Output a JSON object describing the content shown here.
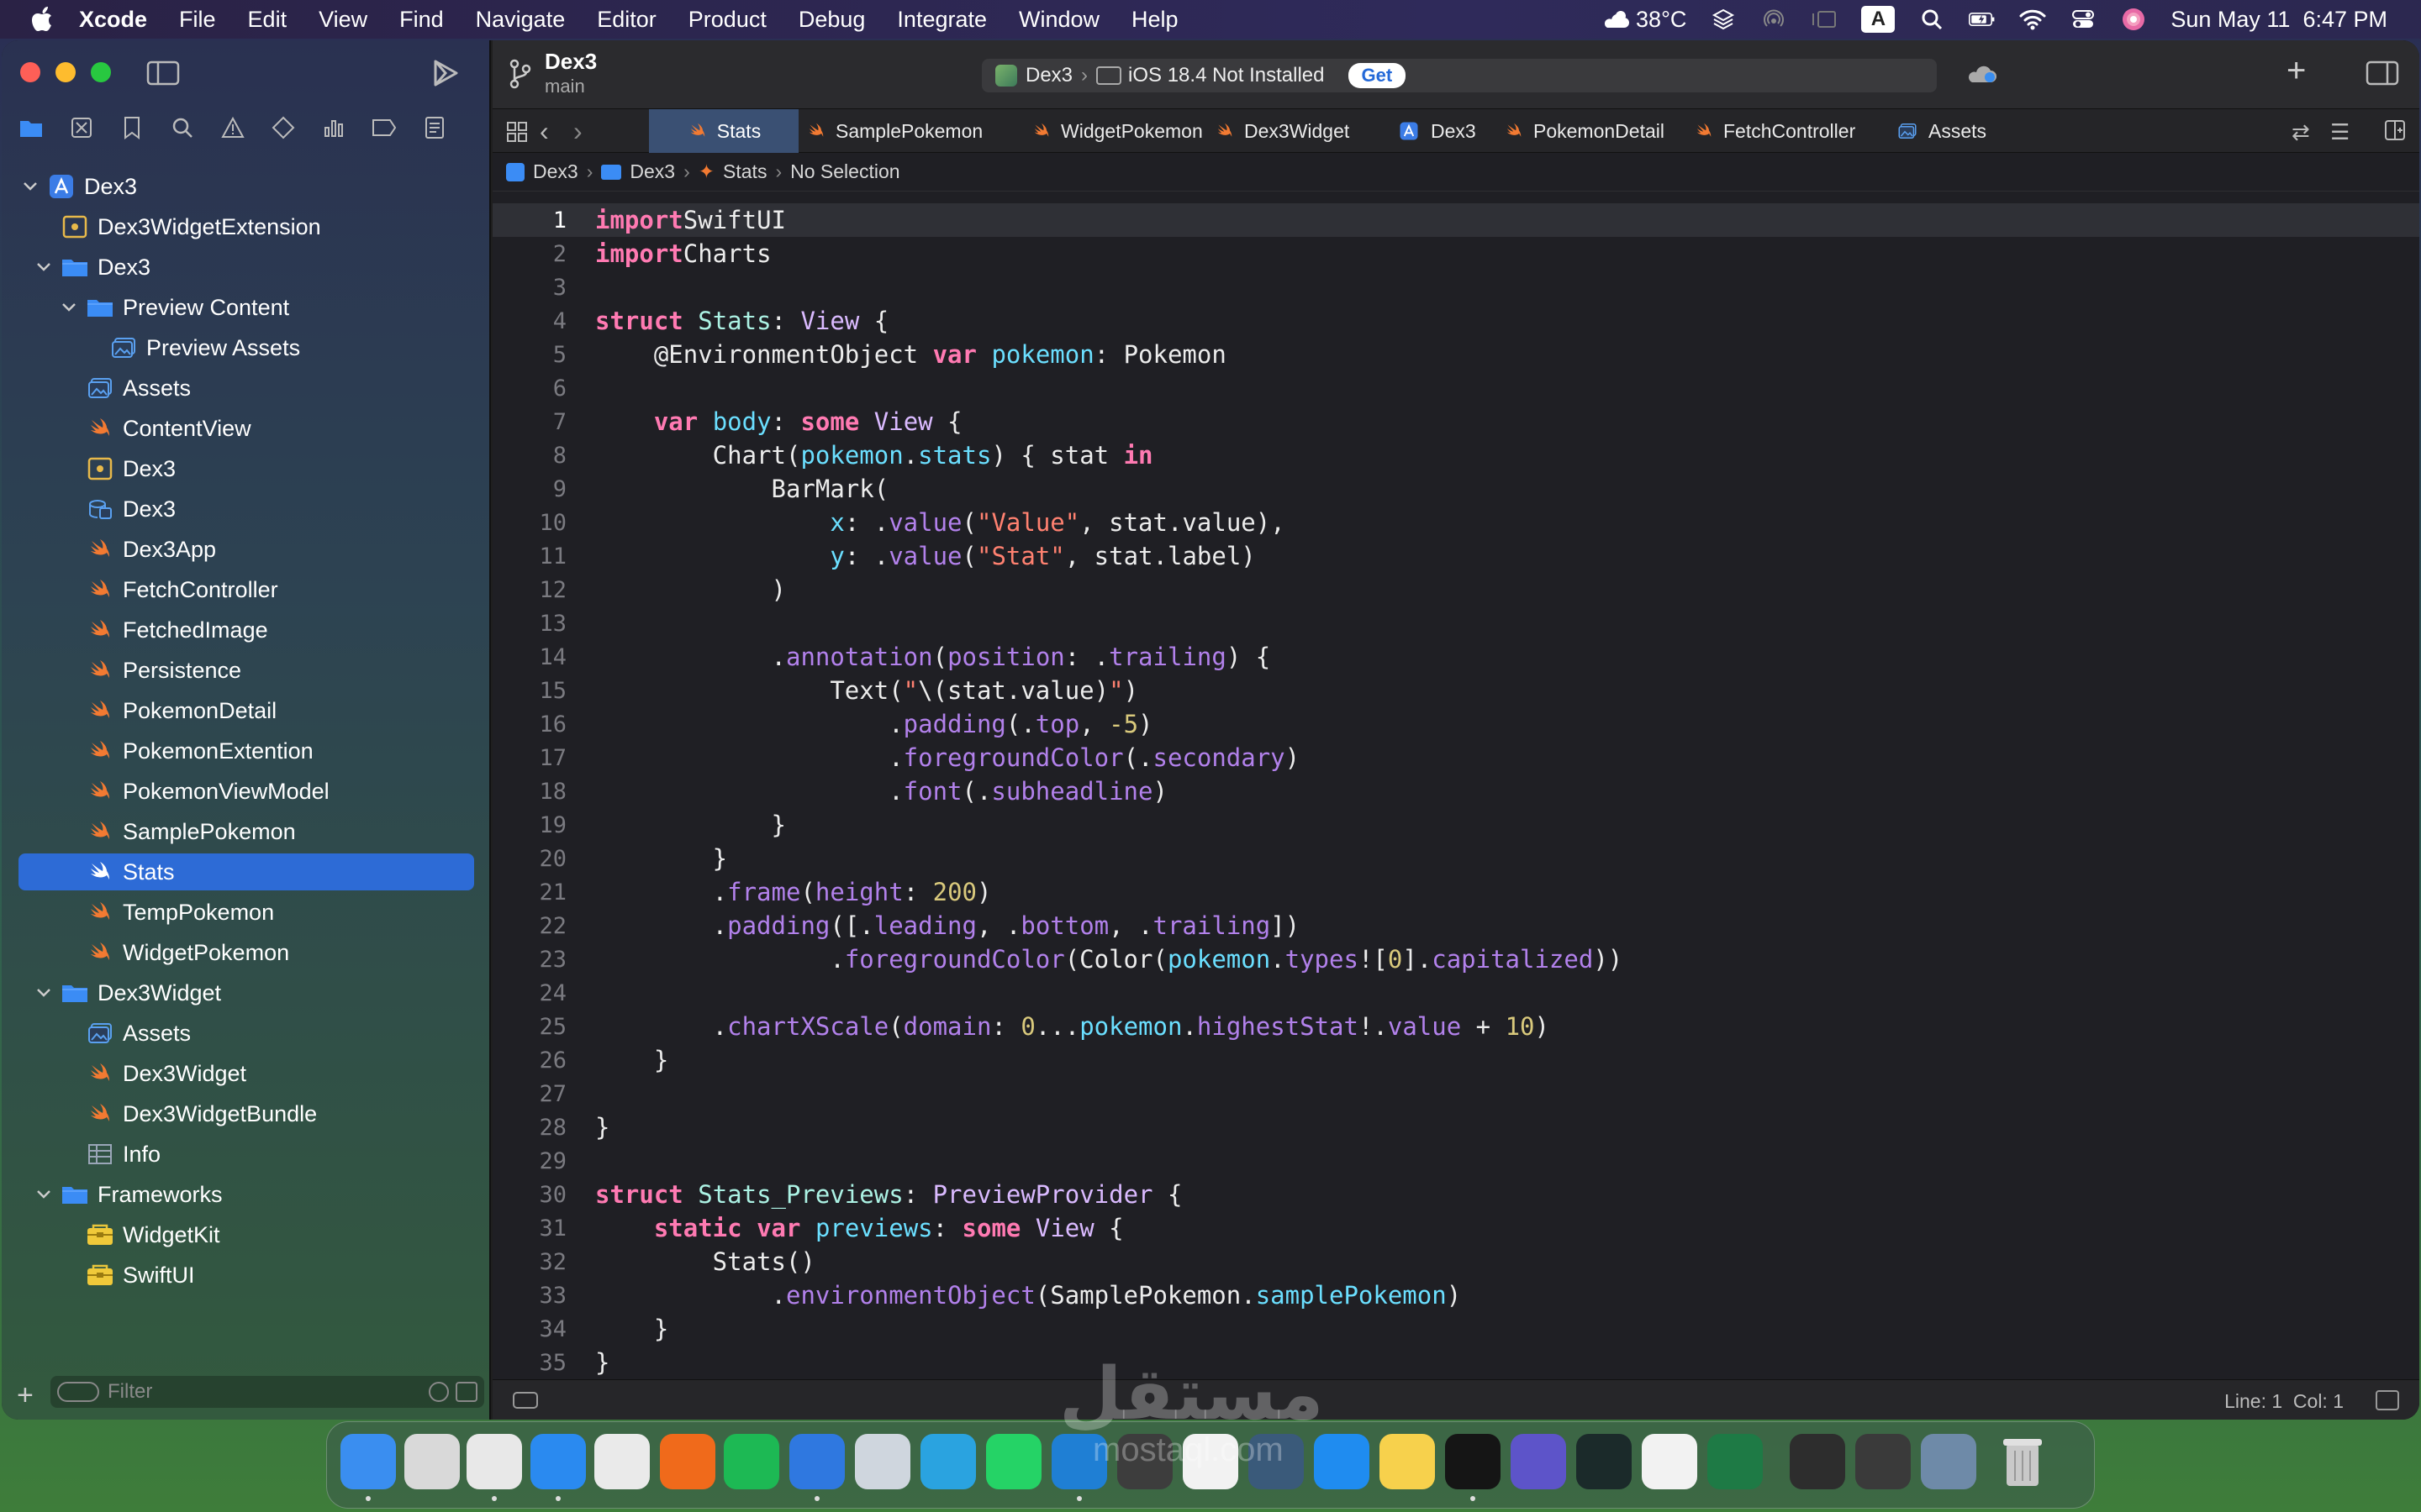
{
  "menubar": {
    "app_name": "Xcode",
    "items": [
      "File",
      "Edit",
      "View",
      "Find",
      "Navigate",
      "Editor",
      "Product",
      "Debug",
      "Integrate",
      "Window",
      "Help"
    ],
    "weather": "38°C",
    "input_source": "A",
    "datetime": "Sun May 11  6:47 PM"
  },
  "project": {
    "name": "Dex3",
    "branch": "main"
  },
  "scheme": {
    "target": "Dex3",
    "destination": "iOS 18.4 Not Installed",
    "get_label": "Get"
  },
  "tabs": [
    "Stats",
    "SamplePokemon",
    "WidgetPokemon",
    "Dex3Widget",
    "Dex3",
    "PokemonDetail",
    "FetchController",
    "Assets"
  ],
  "active_tab": "Stats",
  "breadcrumb": [
    "Dex3",
    "Dex3",
    "Stats",
    "No Selection"
  ],
  "navigator": {
    "items": [
      {
        "label": "Dex3",
        "icon": "project-icon",
        "depth": 0,
        "disclosure": "open"
      },
      {
        "label": "Dex3WidgetExtension",
        "icon": "extension-icon",
        "depth": 1,
        "disclosure": "none"
      },
      {
        "label": "Dex3",
        "icon": "folder-icon",
        "depth": 1,
        "disclosure": "open"
      },
      {
        "label": "Preview Content",
        "icon": "folder-icon",
        "depth": 2,
        "disclosure": "open"
      },
      {
        "label": "Preview Assets",
        "icon": "assets-icon",
        "depth": 3,
        "disclosure": "none"
      },
      {
        "label": "Assets",
        "icon": "assets-icon",
        "depth": 2,
        "disclosure": "none"
      },
      {
        "label": "ContentView",
        "icon": "swift-icon",
        "depth": 2,
        "disclosure": "none"
      },
      {
        "label": "Dex3",
        "icon": "entitlements-icon",
        "depth": 2,
        "disclosure": "none"
      },
      {
        "label": "Dex3",
        "icon": "coredata-icon",
        "depth": 2,
        "disclosure": "none"
      },
      {
        "label": "Dex3App",
        "icon": "swift-icon",
        "depth": 2,
        "disclosure": "none"
      },
      {
        "label": "FetchController",
        "icon": "swift-icon",
        "depth": 2,
        "disclosure": "none"
      },
      {
        "label": "FetchedImage",
        "icon": "swift-icon",
        "depth": 2,
        "disclosure": "none"
      },
      {
        "label": "Persistence",
        "icon": "swift-icon",
        "depth": 2,
        "disclosure": "none"
      },
      {
        "label": "PokemonDetail",
        "icon": "swift-icon",
        "depth": 2,
        "disclosure": "none"
      },
      {
        "label": "PokemonExtention",
        "icon": "swift-icon",
        "depth": 2,
        "disclosure": "none"
      },
      {
        "label": "PokemonViewModel",
        "icon": "swift-icon",
        "depth": 2,
        "disclosure": "none"
      },
      {
        "label": "SamplePokemon",
        "icon": "swift-icon",
        "depth": 2,
        "disclosure": "none"
      },
      {
        "label": "Stats",
        "icon": "swift-icon",
        "depth": 2,
        "disclosure": "none",
        "selected": true
      },
      {
        "label": "TempPokemon",
        "icon": "swift-icon",
        "depth": 2,
        "disclosure": "none"
      },
      {
        "label": "WidgetPokemon",
        "icon": "swift-icon",
        "depth": 2,
        "disclosure": "none"
      },
      {
        "label": "Dex3Widget",
        "icon": "folder-icon",
        "depth": 1,
        "disclosure": "open"
      },
      {
        "label": "Assets",
        "icon": "assets-icon",
        "depth": 2,
        "disclosure": "none"
      },
      {
        "label": "Dex3Widget",
        "icon": "swift-icon",
        "depth": 2,
        "disclosure": "none"
      },
      {
        "label": "Dex3WidgetBundle",
        "icon": "swift-icon",
        "depth": 2,
        "disclosure": "none"
      },
      {
        "label": "Info",
        "icon": "plist-icon",
        "depth": 2,
        "disclosure": "none"
      },
      {
        "label": "Frameworks",
        "icon": "folder-icon",
        "depth": 1,
        "disclosure": "open"
      },
      {
        "label": "WidgetKit",
        "icon": "framework-icon",
        "depth": 2,
        "disclosure": "none"
      },
      {
        "label": "SwiftUI",
        "icon": "framework-icon",
        "depth": 2,
        "disclosure": "none"
      }
    ],
    "filter_placeholder": "Filter"
  },
  "code": [
    [
      [
        "k",
        "import"
      ],
      [
        "",
        "SwiftUI"
      ]
    ],
    [
      [
        "k",
        "import"
      ],
      [
        "",
        "Charts"
      ]
    ],
    [],
    [
      [
        "k",
        "struct"
      ],
      [
        "",
        " "
      ],
      [
        "tn",
        "Stats"
      ],
      [
        "",
        ": "
      ],
      [
        "t",
        "View"
      ],
      [
        "",
        " {"
      ]
    ],
    [
      [
        "",
        "    @EnvironmentObject "
      ],
      [
        "k",
        "var"
      ],
      [
        "",
        " "
      ],
      [
        "v",
        "pokemon"
      ],
      [
        "",
        ": Pokemon"
      ]
    ],
    [],
    [
      [
        "",
        "    "
      ],
      [
        "k",
        "var"
      ],
      [
        "",
        " "
      ],
      [
        "v",
        "body"
      ],
      [
        "",
        ": "
      ],
      [
        "k",
        "some"
      ],
      [
        "",
        " "
      ],
      [
        "t",
        "View"
      ],
      [
        "",
        " {"
      ]
    ],
    [
      [
        "",
        "        Chart("
      ],
      [
        "v",
        "pokemon"
      ],
      [
        "",
        "."
      ],
      [
        "v",
        "stats"
      ],
      [
        "",
        ") { stat "
      ],
      [
        "k",
        "in"
      ]
    ],
    [
      [
        "",
        "            BarMark("
      ]
    ],
    [
      [
        "",
        "                "
      ],
      [
        "v",
        "x"
      ],
      [
        "",
        ": ."
      ],
      [
        "f",
        "value"
      ],
      [
        "",
        "("
      ],
      [
        "s",
        "\"Value\""
      ],
      [
        "",
        ", stat.value),"
      ]
    ],
    [
      [
        "",
        "                "
      ],
      [
        "v",
        "y"
      ],
      [
        "",
        ": ."
      ],
      [
        "f",
        "value"
      ],
      [
        "",
        "("
      ],
      [
        "s",
        "\"Stat\""
      ],
      [
        "",
        ", stat.label)"
      ]
    ],
    [
      [
        "",
        "            )"
      ]
    ],
    [],
    [
      [
        "",
        "            ."
      ],
      [
        "f",
        "annotation"
      ],
      [
        "",
        "("
      ],
      [
        "f",
        "position"
      ],
      [
        "",
        ": ."
      ],
      [
        "f",
        "trailing"
      ],
      [
        "",
        ") {"
      ]
    ],
    [
      [
        "",
        "                Text("
      ],
      [
        "s",
        "\""
      ],
      [
        "",
        "\\(stat.value)"
      ],
      [
        "s",
        "\""
      ],
      [
        "",
        ")"
      ]
    ],
    [
      [
        "",
        "                    ."
      ],
      [
        "f",
        "padding"
      ],
      [
        "",
        "(."
      ],
      [
        "f",
        "top"
      ],
      [
        "",
        ", "
      ],
      [
        "n",
        "-5"
      ],
      [
        "",
        ")"
      ]
    ],
    [
      [
        "",
        "                    ."
      ],
      [
        "f",
        "foregroundColor"
      ],
      [
        "",
        "(."
      ],
      [
        "f",
        "secondary"
      ],
      [
        "",
        ")"
      ]
    ],
    [
      [
        "",
        "                    ."
      ],
      [
        "f",
        "font"
      ],
      [
        "",
        "(."
      ],
      [
        "f",
        "subheadline"
      ],
      [
        "",
        ")"
      ]
    ],
    [
      [
        "",
        "            }"
      ]
    ],
    [
      [
        "",
        "        }"
      ]
    ],
    [
      [
        "",
        "        ."
      ],
      [
        "f",
        "frame"
      ],
      [
        "",
        "("
      ],
      [
        "f",
        "height"
      ],
      [
        "",
        ": "
      ],
      [
        "n",
        "200"
      ],
      [
        "",
        ")"
      ]
    ],
    [
      [
        "",
        "        ."
      ],
      [
        "f",
        "padding"
      ],
      [
        "",
        "([."
      ],
      [
        "f",
        "leading"
      ],
      [
        "",
        ", ."
      ],
      [
        "f",
        "bottom"
      ],
      [
        "",
        ", ."
      ],
      [
        "f",
        "trailing"
      ],
      [
        "",
        "])"
      ]
    ],
    [
      [
        "",
        "                ."
      ],
      [
        "f",
        "foregroundColor"
      ],
      [
        "",
        "(Color("
      ],
      [
        "v",
        "pokemon"
      ],
      [
        "",
        "."
      ],
      [
        "f",
        "types"
      ],
      [
        "",
        "!["
      ],
      [
        "n",
        "0"
      ],
      [
        "",
        "]."
      ],
      [
        "f",
        "capitalized"
      ],
      [
        "",
        "))"
      ]
    ],
    [],
    [
      [
        "",
        "        ."
      ],
      [
        "f",
        "chartXScale"
      ],
      [
        "",
        "("
      ],
      [
        "f",
        "domain"
      ],
      [
        "",
        ": "
      ],
      [
        "n",
        "0"
      ],
      [
        "",
        "..."
      ],
      [
        "v",
        "pokemon"
      ],
      [
        "",
        "."
      ],
      [
        "f",
        "highestStat"
      ],
      [
        "",
        "!."
      ],
      [
        "f",
        "value"
      ],
      [
        "",
        " + "
      ],
      [
        "n",
        "10"
      ],
      [
        "",
        ")"
      ]
    ],
    [
      [
        "",
        "    }"
      ]
    ],
    [],
    [
      [
        "",
        "}"
      ]
    ],
    [],
    [
      [
        "k",
        "struct"
      ],
      [
        "",
        " "
      ],
      [
        "tn",
        "Stats_Previews"
      ],
      [
        "",
        ": "
      ],
      [
        "t",
        "PreviewProvider"
      ],
      [
        "",
        " {"
      ]
    ],
    [
      [
        "",
        "    "
      ],
      [
        "k",
        "static"
      ],
      [
        "",
        " "
      ],
      [
        "k",
        "var"
      ],
      [
        "",
        " "
      ],
      [
        "v",
        "previews"
      ],
      [
        "",
        ": "
      ],
      [
        "k",
        "some"
      ],
      [
        "",
        " "
      ],
      [
        "t",
        "View"
      ],
      [
        "",
        " {"
      ]
    ],
    [
      [
        "",
        "        Stats()"
      ]
    ],
    [
      [
        "",
        "            ."
      ],
      [
        "f",
        "environmentObject"
      ],
      [
        "",
        "(SamplePokemon."
      ],
      [
        "v",
        "samplePokemon"
      ],
      [
        "",
        ")"
      ]
    ],
    [
      [
        "",
        "    }"
      ]
    ],
    [
      [
        "",
        "}"
      ]
    ]
  ],
  "status": {
    "line_col": "Line: 1  Col: 1"
  },
  "dock": [
    {
      "name": "finder-icon",
      "color": "#3a8ef0"
    },
    {
      "name": "launchpad-icon",
      "color": "#d9d9d9"
    },
    {
      "name": "chrome-icon",
      "color": "#e8e8e8"
    },
    {
      "name": "safari-icon",
      "color": "#2a8af0"
    },
    {
      "name": "photos-icon",
      "color": "#eaeaea"
    },
    {
      "name": "firefox-icon",
      "color": "#f06a1b"
    },
    {
      "name": "spotify-icon",
      "color": "#1db954"
    },
    {
      "name": "xcode-icon",
      "color": "#2f78e0"
    },
    {
      "name": "preview-icon",
      "color": "#cfd6de"
    },
    {
      "name": "telegram-icon",
      "color": "#2aa3e0"
    },
    {
      "name": "whatsapp-icon",
      "color": "#25d366"
    },
    {
      "name": "vscode-icon",
      "color": "#1f7fd4"
    },
    {
      "name": "sublime-icon",
      "color": "#3d3d3d"
    },
    {
      "name": "chatgpt-icon",
      "color": "#f2f2f2"
    },
    {
      "name": "postman-icon",
      "color": "#3a5a7a"
    },
    {
      "name": "appstore-icon",
      "color": "#1f8cf0"
    },
    {
      "name": "notes-icon",
      "color": "#f7d14c"
    },
    {
      "name": "terminal-icon",
      "color": "#151515"
    },
    {
      "name": "d-app-icon",
      "color": "#5d54c9"
    },
    {
      "name": "circle-app-icon",
      "color": "#1b2a2a"
    },
    {
      "name": "textedit-icon",
      "color": "#f2f2f2"
    },
    {
      "name": "excel-icon",
      "color": "#1e7a45"
    },
    {
      "name": "cube-app-icon",
      "color": "#2d2d2d"
    },
    {
      "name": "quicktime-icon",
      "color": "#3a3a3a"
    },
    {
      "name": "screenshot-icon",
      "color": "#6e8aa8"
    },
    {
      "name": "trash-icon",
      "color": "#b9b9b9"
    }
  ]
}
